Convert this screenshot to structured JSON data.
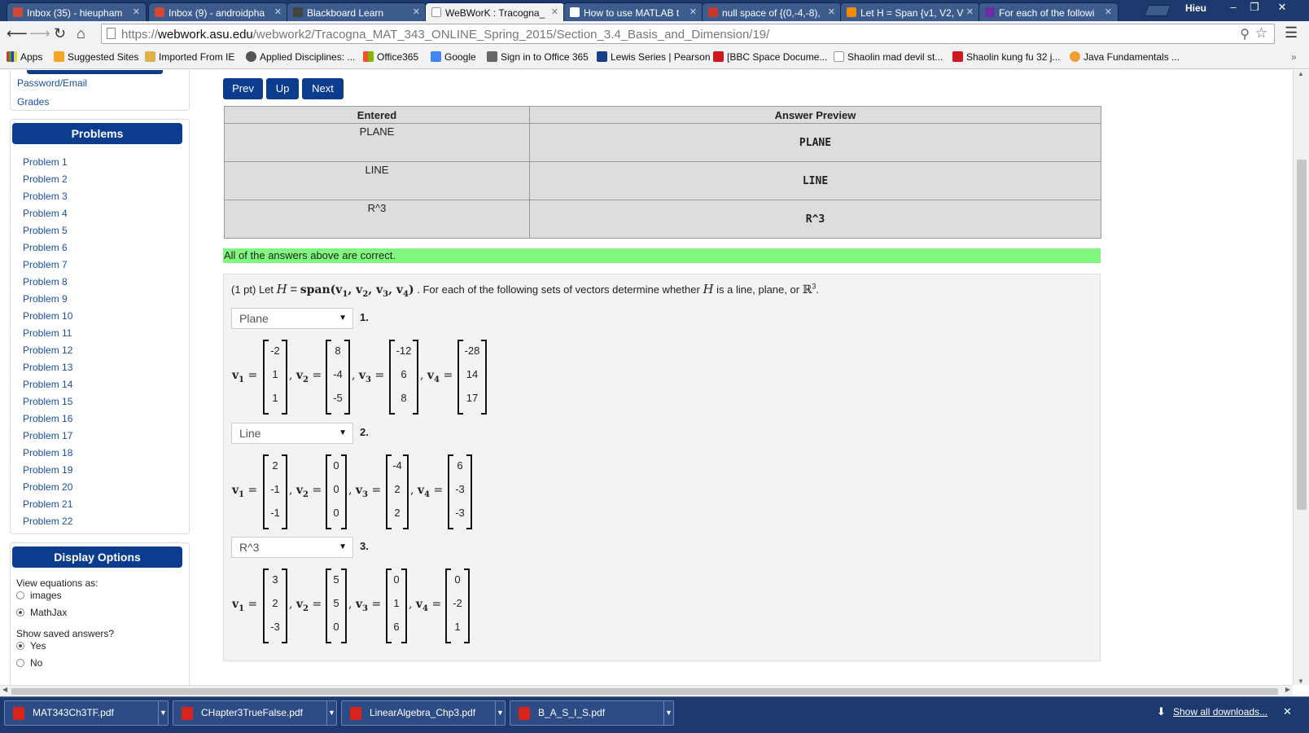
{
  "browser": {
    "tabs": [
      {
        "title": "Inbox (35) - hieupham",
        "fav": "#d14836",
        "active": false
      },
      {
        "title": "Inbox (9) - androidpha",
        "fav": "#d14836",
        "active": false
      },
      {
        "title": "Blackboard Learn",
        "fav": "#444444",
        "active": false
      },
      {
        "title": "WeBWorK : Tracogna_",
        "fav": "#ffffff",
        "active": true
      },
      {
        "title": "How to use MATLAB t",
        "fav": "#ffffff",
        "active": false
      },
      {
        "title": "null space of {(0,-4,-8),",
        "fav": "#c23a2e",
        "active": false
      },
      {
        "title": "Let H = Span {v1, V2, V",
        "fav": "#f28b00",
        "active": false
      },
      {
        "title": "For each of the followi",
        "fav": "#6b2ca0",
        "active": false
      }
    ],
    "profile": "Hieu",
    "url_prefix": "https://",
    "url_host": "webwork.asu.edu",
    "url_path": "/webwork2/Tracogna_MAT_343_ONLINE_Spring_2015/Section_3.4_Basis_and_Dimension/19/",
    "bookmarks": [
      "Apps",
      "Suggested Sites",
      "Imported From IE",
      "Applied Disciplines: ...",
      "Office365",
      "Google",
      "Sign in to Office 365",
      "Lewis Series | Pearson",
      "[BBC Space Docume...",
      "Shaolin mad devil st...",
      "Shaolin kung fu 32 j...",
      "Java Fundamentals ..."
    ]
  },
  "sidebar": {
    "links": [
      "Password/Email",
      "Grades"
    ],
    "problems_heading": "Problems",
    "problems": [
      "Problem 1",
      "Problem 2",
      "Problem 3",
      "Problem 4",
      "Problem 5",
      "Problem 6",
      "Problem 7",
      "Problem 8",
      "Problem 9",
      "Problem 10",
      "Problem 11",
      "Problem 12",
      "Problem 13",
      "Problem 14",
      "Problem 15",
      "Problem 16",
      "Problem 17",
      "Problem 18",
      "Problem 19",
      "Problem 20",
      "Problem 21",
      "Problem 22"
    ],
    "display_heading": "Display Options",
    "view_label": "View equations as:",
    "view_options": [
      "images",
      "MathJax"
    ],
    "view_selected": "MathJax",
    "saved_label": "Show saved answers?",
    "saved_options": [
      "Yes",
      "No"
    ],
    "saved_selected": "Yes"
  },
  "nav": {
    "prev": "Prev",
    "up": "Up",
    "next": "Next"
  },
  "results": {
    "headers": [
      "Entered",
      "Answer Preview"
    ],
    "rows": [
      {
        "entered": "PLANE",
        "preview": "PLANE"
      },
      {
        "entered": "LINE",
        "preview": "LINE"
      },
      {
        "entered": "R^3",
        "preview": "R^3"
      }
    ],
    "message": "All of the answers above are correct."
  },
  "problem": {
    "points": "(1 pt) Let",
    "H": "H",
    "eq": "=",
    "span": "span(v",
    "span_rest": ", v",
    "statement_middle": ". For each of the following sets of vectors determine whether",
    "statement_end": "is a line, plane, or",
    "R": "ℝ",
    "sup": "3",
    "period": ".",
    "parts": [
      {
        "number": "1.",
        "answer": "Plane",
        "vectors": [
          [
            "-2",
            "1",
            "1"
          ],
          [
            "8",
            "-4",
            "-5"
          ],
          [
            "-12",
            "6",
            "8"
          ],
          [
            "-28",
            "14",
            "17"
          ]
        ]
      },
      {
        "number": "2.",
        "answer": "Line",
        "vectors": [
          [
            "2",
            "-1",
            "-1"
          ],
          [
            "0",
            "0",
            "0"
          ],
          [
            "-4",
            "2",
            "2"
          ],
          [
            "6",
            "-3",
            "-3"
          ]
        ]
      },
      {
        "number": "3.",
        "answer": "R^3",
        "vectors": [
          [
            "3",
            "2",
            "-3"
          ],
          [
            "5",
            "5",
            "0"
          ],
          [
            "0",
            "1",
            "6"
          ],
          [
            "0",
            "-2",
            "1"
          ]
        ]
      }
    ]
  },
  "downloads": {
    "files": [
      "MAT343Ch3TF.pdf",
      "CHapter3TrueFalse.pdf",
      "LinearAlgebra_Chp3.pdf",
      "B_A_S_I_S.pdf"
    ],
    "show_all": "Show all downloads..."
  }
}
